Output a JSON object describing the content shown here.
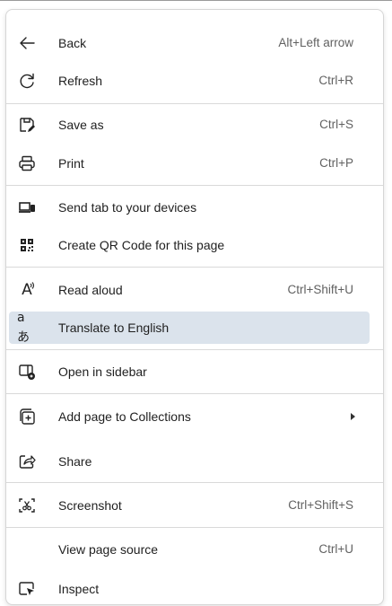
{
  "menu": {
    "items": [
      {
        "label": "Back",
        "shortcut": "Alt+Left arrow",
        "icon": "arrow-left-icon"
      },
      {
        "label": "Refresh",
        "shortcut": "Ctrl+R",
        "icon": "refresh-icon"
      },
      {
        "label": "Save as",
        "shortcut": "Ctrl+S",
        "icon": "save-as-icon"
      },
      {
        "label": "Print",
        "shortcut": "Ctrl+P",
        "icon": "printer-icon"
      },
      {
        "label": "Send tab to your devices",
        "shortcut": "",
        "icon": "send-devices-icon"
      },
      {
        "label": "Create QR Code for this page",
        "shortcut": "",
        "icon": "qr-code-icon"
      },
      {
        "label": "Read aloud",
        "shortcut": "Ctrl+Shift+U",
        "icon": "read-aloud-icon"
      },
      {
        "label": "Translate to English",
        "shortcut": "",
        "icon": "translate-icon"
      },
      {
        "label": "Open in sidebar",
        "shortcut": "",
        "icon": "sidebar-icon"
      },
      {
        "label": "Add page to Collections",
        "shortcut": "",
        "icon": "collections-icon"
      },
      {
        "label": "Share",
        "shortcut": "",
        "icon": "share-icon"
      },
      {
        "label": "Screenshot",
        "shortcut": "Ctrl+Shift+S",
        "icon": "screenshot-icon"
      },
      {
        "label": "View page source",
        "shortcut": "Ctrl+U",
        "icon": ""
      },
      {
        "label": "Inspect",
        "shortcut": "",
        "icon": "inspect-icon"
      }
    ],
    "icon_glyphs": {
      "read_aloud": "A",
      "translate": "aあ"
    },
    "highlight_color": "#dbe3ec"
  }
}
